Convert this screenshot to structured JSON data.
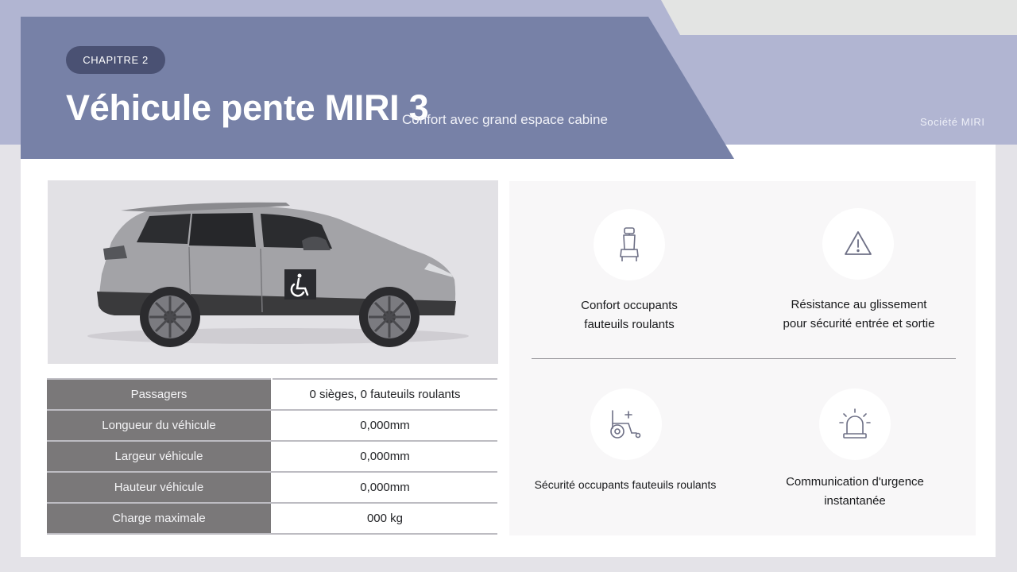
{
  "header": {
    "chapter": "CHAPITRE 2",
    "title": "Véhicule pente MIRI 3",
    "subtitle": "Confort avec grand espace cabine",
    "company": "Société MIRI"
  },
  "specs": [
    {
      "label": "Passagers",
      "value": "0 sièges, 0 fauteuils roulants"
    },
    {
      "label": "Longueur du véhicule",
      "value": "0,000mm"
    },
    {
      "label": "Largeur véhicule",
      "value": "0,000mm"
    },
    {
      "label": "Hauteur véhicule",
      "value": "0,000mm"
    },
    {
      "label": "Charge maximale",
      "value": "000 kg"
    }
  ],
  "features": [
    {
      "icon": "seat-icon",
      "line1": "Confort occupants",
      "line2": "fauteuils roulants"
    },
    {
      "icon": "warning-triangle-icon",
      "line1": "Résistance au glissement",
      "line2": "pour sécurité entrée et sortie"
    },
    {
      "icon": "wheelchair-icon",
      "line1": "Sécurité occupants fauteuils roulants",
      "line2": ""
    },
    {
      "icon": "siren-icon",
      "line1": "Communication d'urgence",
      "line2": "instantanée"
    }
  ],
  "colors": {
    "header_panel": "#7781a7",
    "pill": "#4a5173",
    "band": "#b1b5d2",
    "table_label_bg": "#7a7879"
  }
}
